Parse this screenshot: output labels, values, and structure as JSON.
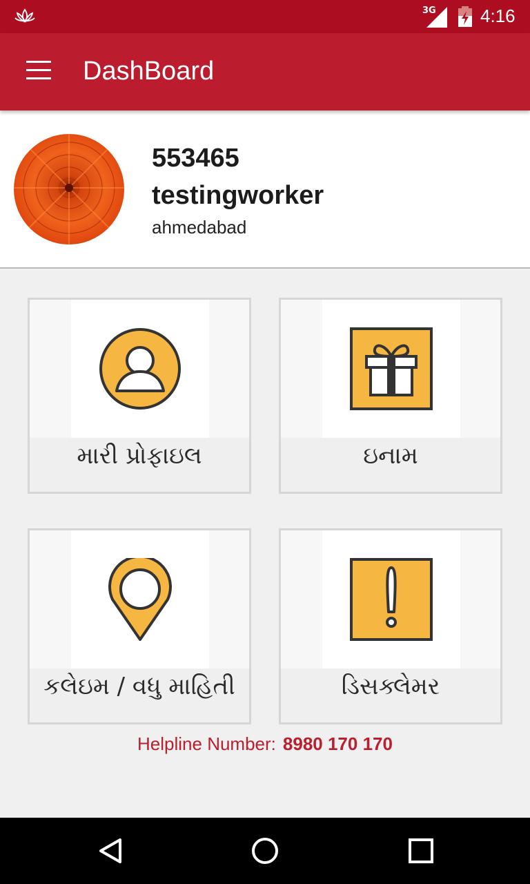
{
  "status_bar": {
    "network": "3G",
    "time": "4:16",
    "icons": [
      "lotus-icon",
      "signal-icon",
      "battery-icon"
    ]
  },
  "app_bar": {
    "title": "DashBoard",
    "menu_icon": "hamburger-menu-icon"
  },
  "profile": {
    "id": "553465",
    "name": "testingworker",
    "city": "ahmedabad"
  },
  "cards": [
    {
      "label": "મારી પ્રોફાઇલ",
      "icon": "user-profile-icon"
    },
    {
      "label": "ઇનામ",
      "icon": "gift-icon"
    },
    {
      "label": "કલેઇમ / વધુ માહિતી",
      "icon": "location-pin-icon"
    },
    {
      "label": "ડિસક્લેમર",
      "icon": "warning-icon"
    }
  ],
  "helpline": {
    "label": "Helpline Number:",
    "number": "8980 170 170"
  },
  "colors": {
    "status_bar": "#ad0d21",
    "app_bar": "#bb1c2e",
    "icon_fill": "#f6b642",
    "helpline": "#b8202f"
  },
  "nav_bar": {
    "icons": [
      "back-icon",
      "home-icon",
      "recents-icon"
    ]
  }
}
